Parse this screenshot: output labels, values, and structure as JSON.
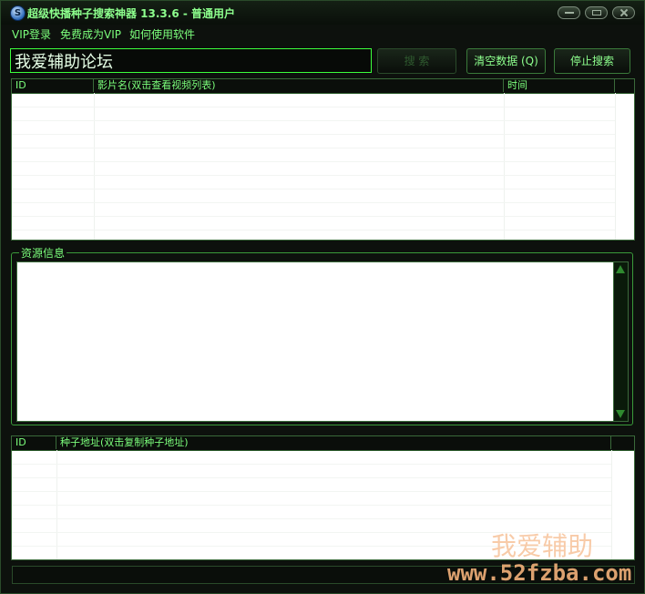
{
  "window": {
    "title": "超级快播种子搜索神器 13.3.6 - 普通用户",
    "app_icon_letter": "S",
    "controls": [
      "minimize-icon",
      "restore-icon",
      "close-icon"
    ]
  },
  "menu": {
    "items": [
      "VIP登录",
      "免费成为VIP",
      "如何使用软件"
    ]
  },
  "search": {
    "value": "我爱辅助论坛"
  },
  "buttons": {
    "search": "搜 索",
    "clear": "清空数据 (Q)",
    "stop": "停止搜索"
  },
  "results_table": {
    "columns": [
      "ID",
      "影片名(双击查看视频列表)",
      "时间"
    ]
  },
  "resource_group": {
    "label": "资源信息"
  },
  "torrent_table": {
    "columns": [
      "ID",
      "种子地址(双击复制种子地址)"
    ]
  },
  "watermark": {
    "line1": "我爱辅助",
    "line2": "www.52fzba.com"
  },
  "colors": {
    "accent": "#7cff7c",
    "background": "#0d110d",
    "border": "#3a9a3a"
  }
}
